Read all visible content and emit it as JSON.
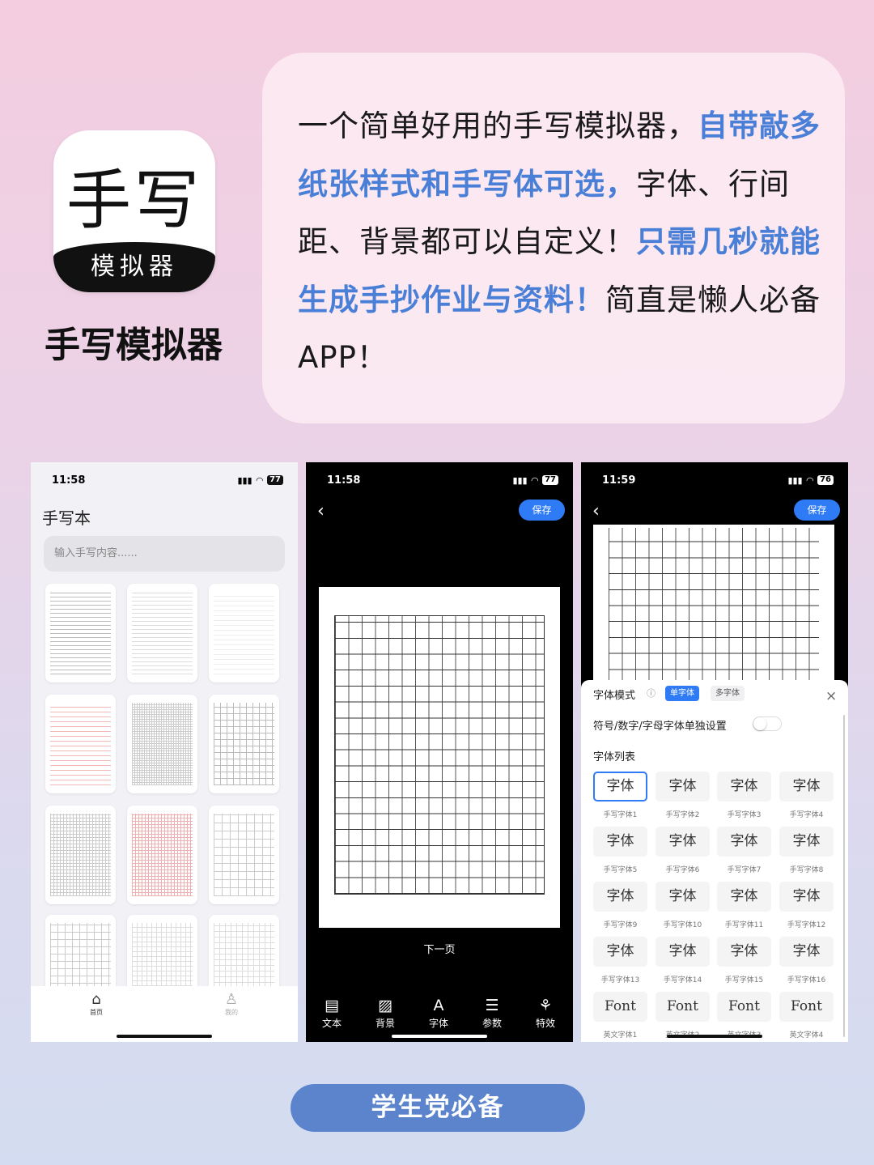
{
  "app": {
    "icon_big": "手写",
    "icon_band": "模拟器",
    "title": "手写模拟器"
  },
  "promo": [
    {
      "t": "一个简单好用的手写模拟器，",
      "hl": false
    },
    {
      "t": "自带敲多纸张样式和手写体可选，",
      "hl": true
    },
    {
      "t": "字体、行间距、背景都可以自定义！",
      "hl": false
    },
    {
      "t": "只需几秒就能生成手抄作业与资料！",
      "hl": true
    },
    {
      "t": "简直是懒人必备APP！",
      "hl": false
    }
  ],
  "colors": {
    "accent": "#4a7fd8",
    "button": "#2f7bf5",
    "cta": "#5b84cc"
  },
  "phone1": {
    "time": "11:58",
    "battery": "77",
    "title": "手写本",
    "input_placeholder": "输入手写内容......",
    "tabs": [
      {
        "label": "首页",
        "icon": "home-icon"
      },
      {
        "label": "我的",
        "icon": "user-icon"
      }
    ]
  },
  "phone2": {
    "time": "11:58",
    "battery": "77",
    "save": "保存",
    "next_page": "下一页",
    "toolbar": [
      {
        "label": "文本",
        "icon": "text-icon"
      },
      {
        "label": "背景",
        "icon": "image-icon"
      },
      {
        "label": "字体",
        "icon": "font-icon"
      },
      {
        "label": "参数",
        "icon": "sliders-icon"
      },
      {
        "label": "特效",
        "icon": "effects-icon"
      }
    ]
  },
  "phone3": {
    "time": "11:59",
    "battery": "76",
    "save": "保存",
    "font_mode": "字体模式",
    "single": "单字体",
    "multi": "多字体",
    "separate_setting": "符号/数字/字母字体单独设置",
    "separate_on": false,
    "font_list": "字体列表",
    "fonts": [
      {
        "sample": "字体",
        "name": "手写字体1",
        "selected": true
      },
      {
        "sample": "字体",
        "name": "手写字体2"
      },
      {
        "sample": "字体",
        "name": "手写字体3"
      },
      {
        "sample": "字体",
        "name": "手写字体4"
      },
      {
        "sample": "字体",
        "name": "手写字体5"
      },
      {
        "sample": "字体",
        "name": "手写字体6"
      },
      {
        "sample": "字体",
        "name": "手写字体7"
      },
      {
        "sample": "字体",
        "name": "手写字体8"
      },
      {
        "sample": "字体",
        "name": "手写字体9"
      },
      {
        "sample": "字体",
        "name": "手写字体10"
      },
      {
        "sample": "字体",
        "name": "手写字体11"
      },
      {
        "sample": "字体",
        "name": "手写字体12"
      },
      {
        "sample": "字体",
        "name": "手写字体13"
      },
      {
        "sample": "字体",
        "name": "手写字体14"
      },
      {
        "sample": "字体",
        "name": "手写字体15"
      },
      {
        "sample": "字体",
        "name": "手写字体16"
      },
      {
        "sample": "Font",
        "name": "英文字体1"
      },
      {
        "sample": "Font",
        "name": "英文字体2"
      },
      {
        "sample": "Font",
        "name": "英文字体3"
      },
      {
        "sample": "Font",
        "name": "英文字体4"
      }
    ]
  },
  "cta": "学生党必备"
}
